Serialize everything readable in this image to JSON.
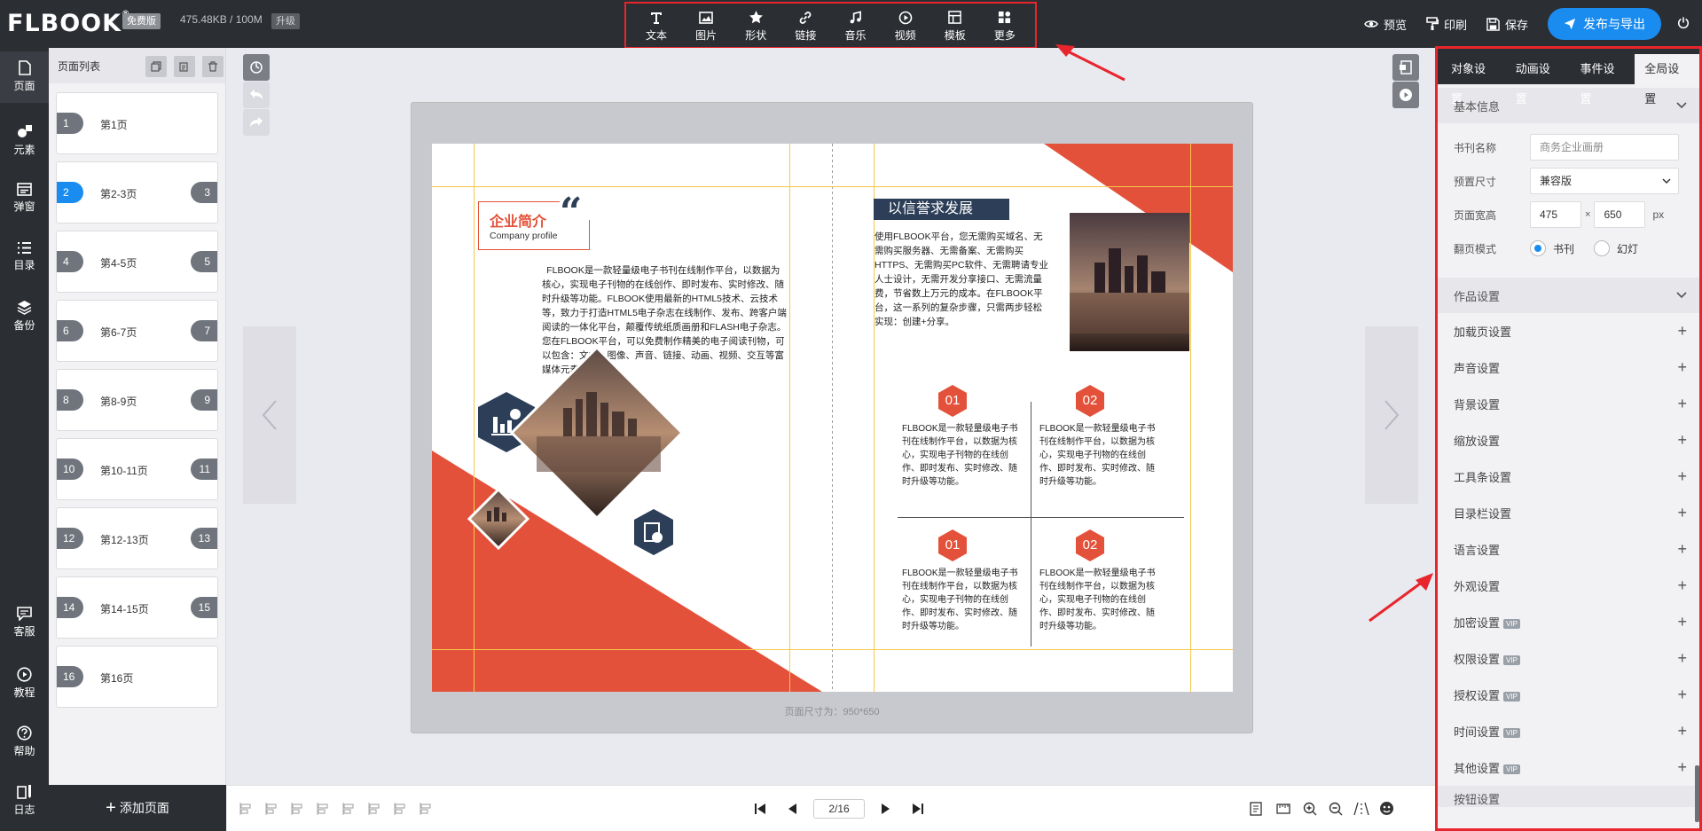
{
  "topbar": {
    "logo": "FLBOOK",
    "edition": "免费版",
    "storage": "475.48KB / 100M",
    "upgrade": "升级",
    "tools": [
      {
        "label": "文本",
        "icon": "text-icon"
      },
      {
        "label": "图片",
        "icon": "image-icon"
      },
      {
        "label": "形状",
        "icon": "star-icon"
      },
      {
        "label": "链接",
        "icon": "link-icon"
      },
      {
        "label": "音乐",
        "icon": "music-icon"
      },
      {
        "label": "视频",
        "icon": "video-icon"
      },
      {
        "label": "模板",
        "icon": "template-icon"
      },
      {
        "label": "更多",
        "icon": "more-icon"
      }
    ],
    "preview": "预览",
    "print": "印刷",
    "save": "保存",
    "publish": "发布与导出"
  },
  "leftnav": {
    "top": [
      {
        "label": "页面",
        "icon": "page-icon"
      },
      {
        "label": "元素",
        "icon": "elements-icon"
      },
      {
        "label": "弹窗",
        "icon": "popup-icon"
      },
      {
        "label": "目录",
        "icon": "toc-icon"
      },
      {
        "label": "备份",
        "icon": "backup-icon"
      }
    ],
    "bottom": [
      {
        "label": "客服",
        "icon": "chat-icon"
      },
      {
        "label": "教程",
        "icon": "play-icon"
      },
      {
        "label": "帮助",
        "icon": "help-icon"
      },
      {
        "label": "日志",
        "icon": "log-icon"
      }
    ]
  },
  "pagelist": {
    "title": "页面列表",
    "add_label": "添加页面",
    "pages": [
      {
        "left": "1",
        "right": "",
        "label": "第1页",
        "active": false
      },
      {
        "left": "2",
        "right": "3",
        "label": "第2-3页",
        "active": true
      },
      {
        "left": "4",
        "right": "5",
        "label": "第4-5页",
        "active": false
      },
      {
        "left": "6",
        "right": "7",
        "label": "第6-7页",
        "active": false
      },
      {
        "left": "8",
        "right": "9",
        "label": "第8-9页",
        "active": false
      },
      {
        "left": "10",
        "right": "11",
        "label": "第10-11页",
        "active": false
      },
      {
        "left": "12",
        "right": "13",
        "label": "第12-13页",
        "active": false
      },
      {
        "left": "14",
        "right": "15",
        "label": "第14-15页",
        "active": false
      },
      {
        "left": "16",
        "right": "",
        "label": "第16页",
        "active": false
      }
    ]
  },
  "spread": {
    "left": {
      "title": "企业简介",
      "subtitle": "Company profile",
      "quote": "“",
      "body": "FLBOOK是一款轻量级电子书刊在线制作平台，以数据为核心，实现电子刊物的在线创作、即时发布、实时修改、随时升级等功能。FLBOOK使用最新的HTML5技术、云技术等，致力于打造HTML5电子杂志在线制作、发布、跨客户端阅读的一体化平台，颠覆传统纸质画册和FLASH电子杂志。您在FLBOOK平台，可以免费制作精美的电子阅读刊物，可以包含：文本、图像、声音、链接、动画、视频、交互等富媒体元素。"
    },
    "right": {
      "title": "以信誉求发展",
      "body": "使用FLBOOK平台，您无需购买域名、无需购买服务器、无需备案、无需购买HTTPS、无需购买PC软件、无需聘请专业人士设计，无需开发分享接口、无需流量费，节省数上万元的成本。在FLBOOK平台，这一系列的复杂步骤，只需两步轻松实现：创建+分享。",
      "items": [
        {
          "num": "01",
          "text": "FLBOOK是一款轻量级电子书刊在线制作平台，以数据为核心，实现电子刊物的在线创作、即时发布、实时修改、随时升级等功能。"
        },
        {
          "num": "02",
          "text": "FLBOOK是一款轻量级电子书刊在线制作平台，以数据为核心，实现电子刊物的在线创作、即时发布、实时修改、随时升级等功能。"
        },
        {
          "num": "01",
          "text": "FLBOOK是一款轻量级电子书刊在线制作平台，以数据为核心，实现电子刊物的在线创作、即时发布、实时修改、随时升级等功能。"
        },
        {
          "num": "02",
          "text": "FLBOOK是一款轻量级电子书刊在线制作平台，以数据为核心，实现电子刊物的在线创作、即时发布、实时修改、随时升级等功能。"
        }
      ]
    },
    "size_label": "页面尺寸为：950*650"
  },
  "bottombar": {
    "page_indicator": "2/16"
  },
  "panel": {
    "tabs": [
      "对象设置",
      "动画设置",
      "事件设置",
      "全局设置"
    ],
    "active_tab": 3,
    "basic": {
      "title": "基本信息",
      "name_label": "书刊名称",
      "name_placeholder": "商务企业画册",
      "preset_label": "预置尺寸",
      "preset_value": "兼容版",
      "size_label": "页面宽高",
      "width": "475",
      "times": "×",
      "height": "650",
      "unit": "px",
      "flip_label": "翻页模式",
      "flip_options": [
        "书刊",
        "幻灯"
      ]
    },
    "works": {
      "title": "作品设置",
      "items": [
        {
          "label": "加载页设置",
          "vip": false
        },
        {
          "label": "声音设置",
          "vip": false
        },
        {
          "label": "背景设置",
          "vip": false
        },
        {
          "label": "缩放设置",
          "vip": false
        },
        {
          "label": "工具条设置",
          "vip": false
        },
        {
          "label": "目录栏设置",
          "vip": false
        },
        {
          "label": "语言设置",
          "vip": false
        },
        {
          "label": "外观设置",
          "vip": false
        },
        {
          "label": "加密设置",
          "vip": true
        },
        {
          "label": "权限设置",
          "vip": true
        },
        {
          "label": "授权设置",
          "vip": true
        },
        {
          "label": "时间设置",
          "vip": true
        },
        {
          "label": "其他设置",
          "vip": true
        }
      ]
    },
    "next_section": "按钮设置",
    "vip_tag": "VIP"
  },
  "colors": {
    "accent": "#1a8cf0",
    "brand_red": "#e4513a",
    "navy": "#2c3e58",
    "dark": "#2b2e33",
    "annotation": "#e8252c"
  }
}
